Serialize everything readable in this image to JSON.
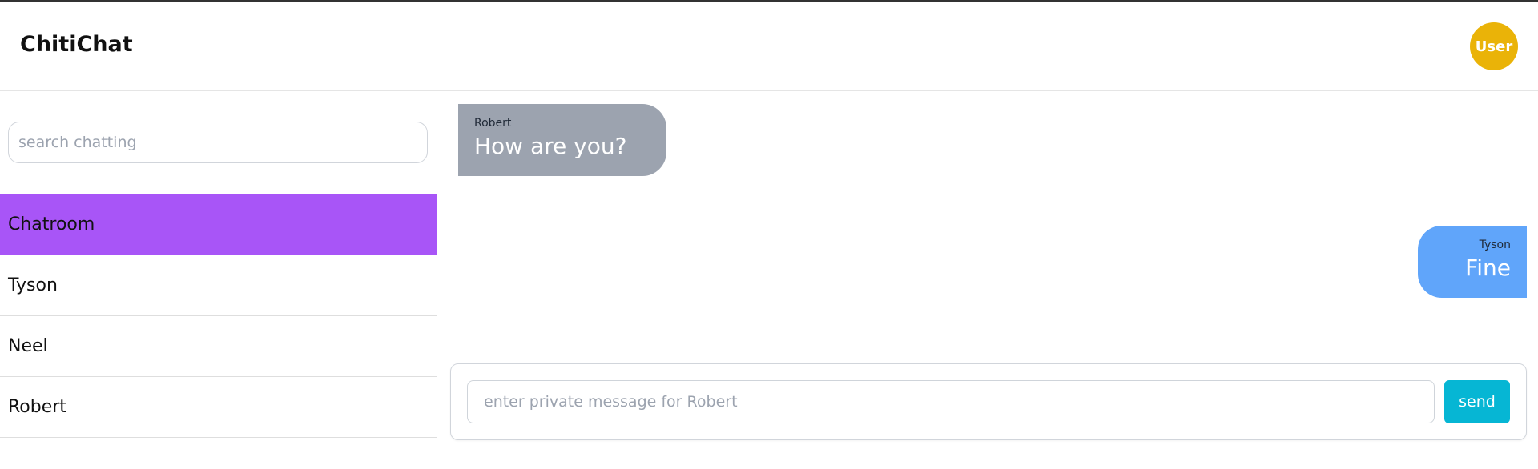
{
  "header": {
    "brand": "ChitiChat",
    "avatar_label": "User"
  },
  "colors": {
    "avatar": "#eab308",
    "active_chat": "#a855f7",
    "incoming_bubble": "#9ca3af",
    "outgoing_bubble": "#60a5fa",
    "send_button": "#06b6d4"
  },
  "sidebar": {
    "search_placeholder": "search chatting",
    "items": [
      {
        "label": "Chatroom",
        "active": true
      },
      {
        "label": "Tyson",
        "active": false
      },
      {
        "label": "Neel",
        "active": false
      },
      {
        "label": "Robert",
        "active": false
      }
    ]
  },
  "messages": [
    {
      "sender": "Robert",
      "text": "How are you?",
      "side": "left"
    },
    {
      "sender": "Tyson",
      "text": "Fine",
      "side": "right"
    }
  ],
  "composer": {
    "placeholder": "enter private message for Robert",
    "send_label": "send"
  }
}
